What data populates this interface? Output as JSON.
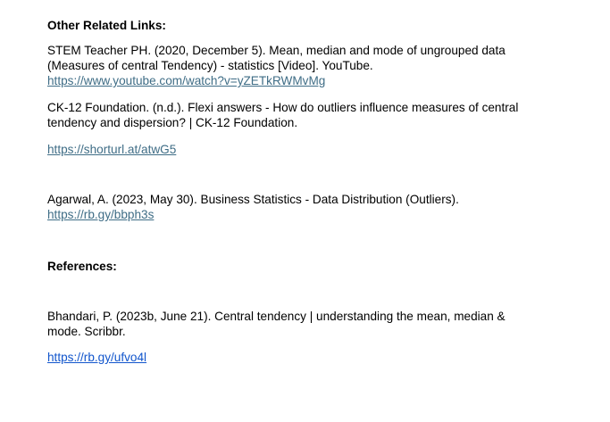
{
  "related": {
    "heading": "Other Related Links:",
    "entries": [
      {
        "lines": [
          "STEM Teacher PH. (2020, December 5). Mean, median and mode of ungrouped data",
          "(Measures of central Tendency) - statistics [Video]. YouTube."
        ],
        "link": "https://www.youtube.com/watch?v=yZETkRWMvMg"
      },
      {
        "lines": [
          "CK-12 Foundation. (n.d.). Flexi answers - How do outliers influence measures of central",
          "tendency and dispersion? | CK-12 Foundation."
        ],
        "link": "https://shorturl.at/atwG5"
      },
      {
        "lines": [
          "Agarwal, A. (2023, May 30). Business Statistics - Data Distribution (Outliers)."
        ],
        "link": "https://rb.gy/bbph3s"
      }
    ]
  },
  "references": {
    "heading": "References:",
    "entries": [
      {
        "lines": [
          "Bhandari, P. (2023b, June 21). Central tendency | understanding the mean, median &",
          "mode. Scribbr."
        ],
        "link": "https://rb.gy/ufvo4l"
      }
    ]
  },
  "colors": {
    "link_primary": "#3f6d86",
    "link_secondary": "#1155cc",
    "text": "#000000"
  }
}
